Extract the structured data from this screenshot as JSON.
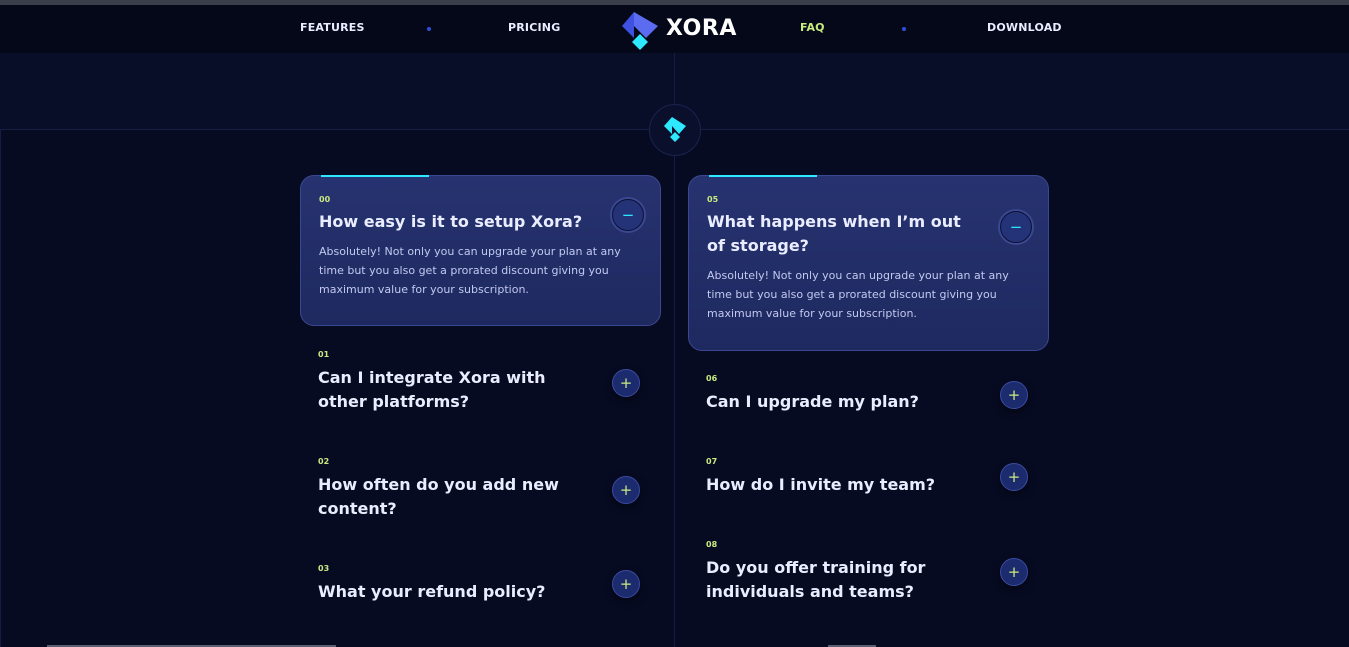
{
  "nav": {
    "left_links": [
      "FEATURES",
      "PRICING"
    ],
    "right_links": [
      "FAQ",
      "DOWNLOAD"
    ],
    "active": "FAQ",
    "brand": "XORA",
    "colors": {
      "accent_green": "#c8ea80",
      "accent_cyan": "#2ee8ff",
      "brand_blue": "#3f51e0"
    }
  },
  "faq": {
    "left": [
      {
        "num": "00",
        "question": "How easy is it to setup Xora?",
        "answer": "Absolutely! Not only you can upgrade your plan at any time but you also get a prorated discount giving you maximum value for your subscription.",
        "open": true,
        "toggle": "−"
      },
      {
        "num": "01",
        "question": "Can I integrate Xora with other platforms?",
        "open": false,
        "toggle": "+"
      },
      {
        "num": "02",
        "question": "How often do you add new content?",
        "open": false,
        "toggle": "+"
      },
      {
        "num": "03",
        "question": "What your refund policy?",
        "open": false,
        "toggle": "+"
      }
    ],
    "right": [
      {
        "num": "05",
        "question": "What happens when I’m out of storage?",
        "answer": "Absolutely! Not only you can upgrade your plan at any time but you also get a prorated discount giving you maximum value for your subscription.",
        "open": true,
        "toggle": "−"
      },
      {
        "num": "06",
        "question": "Can I upgrade my plan?",
        "open": false,
        "toggle": "+"
      },
      {
        "num": "07",
        "question": "How do I invite my team?",
        "open": false,
        "toggle": "+"
      },
      {
        "num": "08",
        "question": "Do you offer training for individuals and teams?",
        "open": false,
        "toggle": "+"
      }
    ]
  }
}
